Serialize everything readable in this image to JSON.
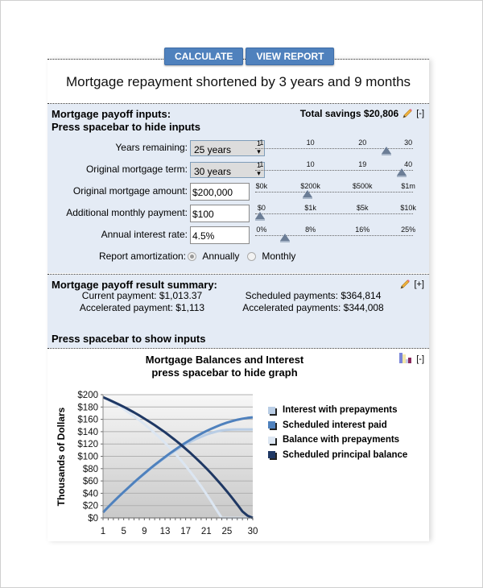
{
  "toolbar": {
    "calculate_label": "CALCULATE",
    "view_report_label": "VIEW REPORT"
  },
  "headline": "Mortgage repayment shortened by 3 years and 9 months",
  "inputs": {
    "title_line1": "Mortgage payoff inputs:",
    "title_line2": "Press spacebar to hide inputs",
    "total_savings": "Total savings $20,806",
    "toggle": "[-]",
    "fields": [
      {
        "label": "Years remaining:",
        "value": "25 years",
        "type": "select",
        "slider": {
          "ticks": [
            "1",
            "10",
            "20",
            "30"
          ],
          "value_fraction": 0.83
        }
      },
      {
        "label": "Original mortgage term:",
        "value": "30 years",
        "type": "select",
        "slider": {
          "ticks": [
            "1",
            "10",
            "19",
            "40"
          ],
          "value_fraction": 0.93
        }
      },
      {
        "label": "Original mortgage amount:",
        "value": "$200,000",
        "type": "text",
        "slider": {
          "ticks": [
            "$0k",
            "$200k",
            "$500k",
            "$1m"
          ],
          "value_fraction": 0.33
        }
      },
      {
        "label": "Additional monthly payment:",
        "value": "$100",
        "type": "text",
        "slider": {
          "ticks": [
            "$0",
            "$1k",
            "$5k",
            "$10k"
          ],
          "value_fraction": 0.03
        }
      },
      {
        "label": "Annual interest rate:",
        "value": "4.5%",
        "type": "text",
        "slider": {
          "ticks": [
            "0%",
            "8%",
            "16%",
            "25%"
          ],
          "value_fraction": 0.19
        }
      }
    ],
    "amortization": {
      "label": "Report amortization:",
      "options": [
        "Annually",
        "Monthly"
      ],
      "selected": "Annually"
    }
  },
  "summary": {
    "title": "Mortgage payoff result summary:",
    "toggle": "[+]",
    "current_payment": "Current payment: $1,013.37",
    "accelerated_payment": "Accelerated payment: $1,113",
    "scheduled_payments": "Scheduled payments: $364,814",
    "accelerated_payments": "Accelerated payments: $344,008",
    "show_inputs": "Press spacebar to show inputs"
  },
  "graph_header": {
    "title_line1": "Mortgage Balances and Interest",
    "title_line2": "press spacebar to hide graph",
    "toggle": "[-]"
  },
  "chart_data": {
    "type": "line",
    "title": "Mortgage Balances and Interest",
    "xlabel": "",
    "ylabel": "Thousands of Dollars",
    "x": [
      1,
      2,
      3,
      4,
      5,
      6,
      7,
      8,
      9,
      10,
      11,
      12,
      13,
      14,
      15,
      16,
      17,
      18,
      19,
      20,
      21,
      22,
      23,
      24,
      25,
      26,
      27,
      28,
      29,
      30
    ],
    "x_tick_labels": [
      "1",
      "5",
      "9",
      "13",
      "17",
      "21",
      "25",
      "30"
    ],
    "x_tick_values": [
      1,
      5,
      9,
      13,
      17,
      21,
      25,
      30
    ],
    "ylim": [
      0,
      200
    ],
    "y_tick_labels": [
      "$0",
      "$20",
      "$40",
      "$60",
      "$80",
      "$100",
      "$120",
      "$140",
      "$160",
      "$180",
      "$200"
    ],
    "grid": true,
    "legend_position": "right",
    "series": [
      {
        "name": "Interest with prepayments",
        "color": "#b9cde5",
        "values": [
          9,
          17.5,
          25.8,
          33.9,
          41.8,
          49.5,
          57,
          64.3,
          71.4,
          78.3,
          85,
          91.4,
          97.6,
          103.5,
          109.1,
          114.4,
          119.3,
          123.9,
          128.1,
          131.8,
          135.1,
          137.9,
          140.2,
          141.9,
          143,
          143.5,
          143.6,
          143.6,
          143.6,
          143.6
        ]
      },
      {
        "name": "Scheduled interest paid",
        "color": "#4f81bd",
        "values": [
          9,
          17.6,
          26,
          34.2,
          42.2,
          50,
          57.6,
          65,
          72.2,
          79.2,
          86,
          92.6,
          99,
          105.1,
          111,
          116.7,
          122.1,
          127.2,
          132.1,
          136.6,
          140.9,
          144.8,
          148.4,
          151.7,
          154.6,
          157.1,
          159.3,
          161,
          162.3,
          163.3
        ]
      },
      {
        "name": "Balance with prepayments",
        "color": "#dce6f2",
        "values": [
          196,
          191.6,
          186.9,
          181.9,
          176.6,
          171,
          165.1,
          158.8,
          152.2,
          145.2,
          137.8,
          130,
          121.8,
          113.2,
          104.1,
          94.5,
          84.5,
          73.9,
          62.8,
          51.2,
          39,
          26.2,
          12.8,
          0,
          0,
          0,
          0,
          0,
          0,
          0
        ]
      },
      {
        "name": "Scheduled principal balance",
        "color": "#1f3864",
        "values": [
          196,
          192.3,
          188.4,
          184.4,
          180.2,
          175.8,
          171.2,
          166.4,
          161.3,
          156.1,
          150.6,
          144.9,
          138.9,
          132.6,
          126.1,
          119.3,
          112.2,
          104.8,
          97,
          88.9,
          80.5,
          71.7,
          62.5,
          53,
          43,
          32.6,
          21.7,
          10.5,
          3.5,
          0
        ]
      }
    ]
  }
}
